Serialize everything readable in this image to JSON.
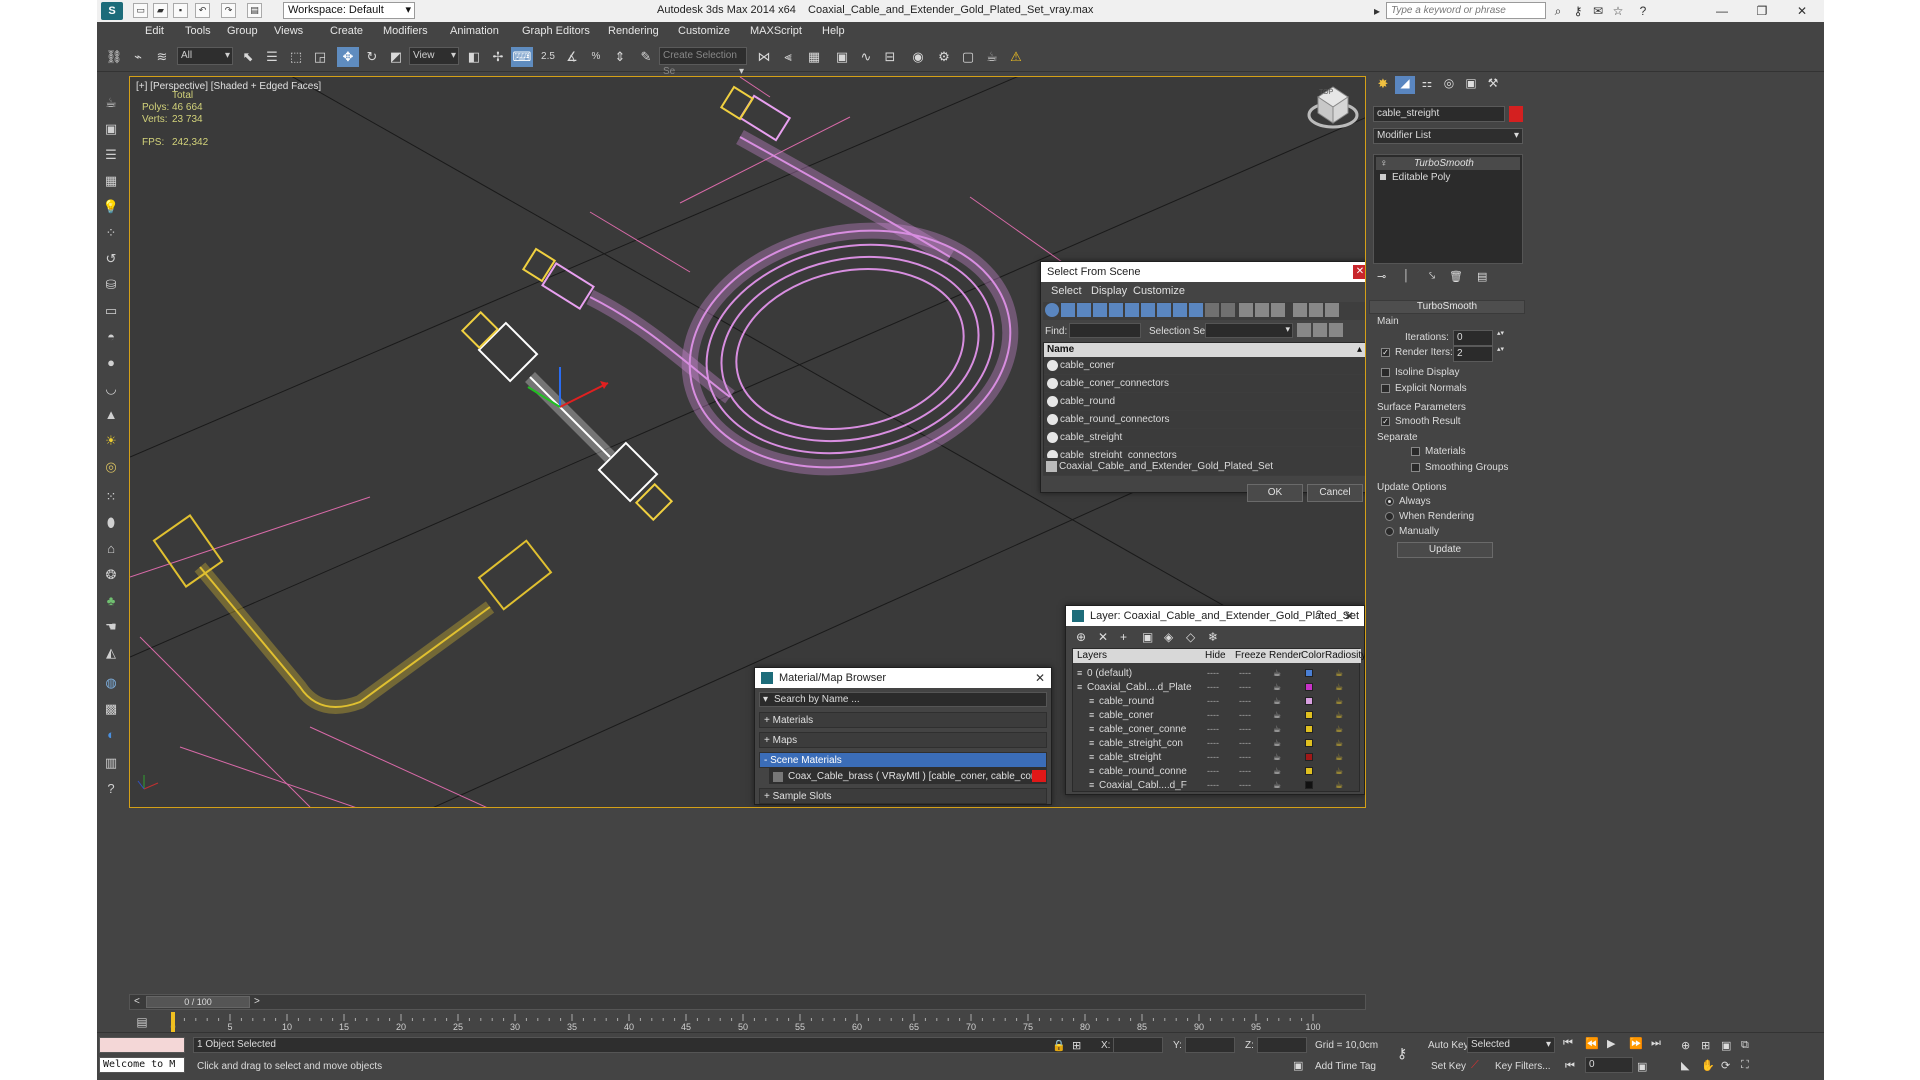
{
  "app": {
    "title": "Autodesk 3ds Max  2014 x64",
    "file": "Coaxial_Cable_and_Extender_Gold_Plated_Set_vray.max",
    "workspace": "Workspace: Default",
    "search_placeholder": "Type a keyword or phrase"
  },
  "menu": [
    "Edit",
    "Tools",
    "Group",
    "Views",
    "Create",
    "Modifiers",
    "Animation",
    "Graph Editors",
    "Rendering",
    "Customize",
    "MAXScript",
    "Help"
  ],
  "toolbar": {
    "filter": "All",
    "ref_coord": "View",
    "snap_value": "2.5",
    "selection_set_placeholder": "Create Selection Se"
  },
  "viewport": {
    "label": "[+] [Perspective] [Shaded + Edged Faces]",
    "stats": {
      "header": "Total",
      "polys_label": "Polys:",
      "polys": "46 664",
      "verts_label": "Verts:",
      "verts": "23 734",
      "fps_label": "FPS:",
      "fps": "242,342"
    },
    "cube_label": "TOP"
  },
  "command_panel": {
    "object_name": "cable_streight",
    "object_color": "#d42020",
    "modifier_list": "Modifier List",
    "stack": [
      "TurboSmooth",
      "Editable Poly"
    ],
    "rollout_title": "TurboSmooth",
    "main_label": "Main",
    "iterations_label": "Iterations:",
    "iterations": "0",
    "render_iters_label": "Render Iters:",
    "render_iters": "2",
    "isoline": "Isoline Display",
    "explicit": "Explicit Normals",
    "surface_params": "Surface Parameters",
    "smooth_result": "Smooth Result",
    "separate": "Separate",
    "materials": "Materials",
    "smoothing_groups": "Smoothing Groups",
    "update_options": "Update Options",
    "always": "Always",
    "when_rendering": "When Rendering",
    "manually": "Manually",
    "update_btn": "Update"
  },
  "select_dialog": {
    "title": "Select From Scene",
    "menus": [
      "Select",
      "Display",
      "Customize"
    ],
    "find_label": "Find:",
    "selection_set_label": "Selection Set:",
    "column": "Name",
    "items": [
      "cable_coner",
      "cable_coner_connectors",
      "cable_round",
      "cable_round_connectors",
      "cable_streight",
      "cable_streight_connectors",
      "Coaxial_Cable_and_Extender_Gold_Plated_Set"
    ],
    "ok": "OK",
    "cancel": "Cancel"
  },
  "material_browser": {
    "title": "Material/Map Browser",
    "search": "Search by Name ...",
    "sections": [
      "+ Materials",
      "+ Maps",
      "- Scene Materials"
    ],
    "material": "Coax_Cable_brass  ( VRayMtl ) [cable_coner, cable_coner_connect...",
    "sample_slots": "+ Sample Slots"
  },
  "layer_dialog": {
    "title": "Layer: Coaxial_Cable_and_Extender_Gold_Plated_Set",
    "columns": [
      "Layers",
      "Hide",
      "Freeze",
      "Render",
      "Color",
      "Radiosity"
    ],
    "rows": [
      {
        "name": "0 (default)",
        "color": "#4a7fd4"
      },
      {
        "name": "Coaxial_Cabl....d_Plate",
        "color": "#c832c8"
      },
      {
        "name": "cable_round",
        "color": "#d8a0e0"
      },
      {
        "name": "cable_coner",
        "color": "#e0c020"
      },
      {
        "name": "cable_coner_conne",
        "color": "#e0c020"
      },
      {
        "name": "cable_streight_con",
        "color": "#e0c020"
      },
      {
        "name": "cable_streight",
        "color": "#a01818"
      },
      {
        "name": "cable_round_conne",
        "color": "#e0c020"
      },
      {
        "name": "Coaxial_Cabl....d_F",
        "color": "#111111"
      }
    ]
  },
  "timeline": {
    "frame": "0 / 100",
    "ticks": [
      "0",
      "5",
      "10",
      "15",
      "20",
      "25",
      "30",
      "35",
      "40",
      "45",
      "50",
      "55",
      "60",
      "65",
      "70",
      "75",
      "80",
      "85",
      "90",
      "95",
      "100"
    ]
  },
  "status": {
    "script": "Welcome to M",
    "selected": "1 Object Selected",
    "prompt": "Click and drag to select and move objects",
    "x_label": "X:",
    "y_label": "Y:",
    "z_label": "Z:",
    "grid": "Grid = 10,0cm",
    "add_time_tag": "Add Time Tag",
    "auto_key": "Auto Key",
    "set_key": "Set Key",
    "key_mode": "Selected",
    "key_filters": "Key Filters...",
    "frame_value": "0"
  }
}
